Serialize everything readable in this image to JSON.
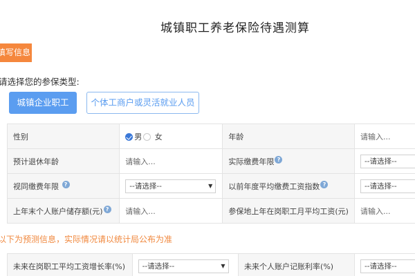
{
  "page": {
    "title": "城镇职工养老保险待遇测算"
  },
  "section": {
    "tag": "填写信息"
  },
  "insurance_type": {
    "prompt": "请选择您的参保类型:",
    "options": [
      "城镇企业职工",
      "个体工商户或灵活就业人员"
    ],
    "selected": "城镇企业职工"
  },
  "form": {
    "rows": [
      {
        "left_label": "性别",
        "gender": {
          "male": "男",
          "female": "女",
          "selected": "男"
        },
        "right_label": "年龄",
        "right_value": "请输入..."
      },
      {
        "left_label": "预计退休年龄",
        "left_value": "请输入...",
        "right_label": "实际缴费年限",
        "right_value": "--请选择--"
      },
      {
        "left_label": "视同缴费年限",
        "left_value": "--请选择--",
        "right_label": "以前年度平均缴费工资指数",
        "right_value": "--请选择--"
      },
      {
        "left_label": "上年末个人账户储存额(元)",
        "left_value": "请输入...",
        "right_label": "参保地上年在岗职工月平均工资(元)",
        "right_value": "请输入..."
      }
    ]
  },
  "notice": {
    "text": "以下为预测信息，实际情况请以统计局公布为准"
  },
  "forecast": {
    "rows": [
      {
        "left_label": "未来在岗职工平均工资增长率(%)",
        "left_value": "--请选择--",
        "right_label": "未来个人账户记账利率(%)",
        "right_value": "--请选择--"
      }
    ]
  },
  "icons": {
    "help": "question-circle-icon",
    "dropdown": "caret-down-icon",
    "radio_checked": "radio-checked-icon"
  }
}
